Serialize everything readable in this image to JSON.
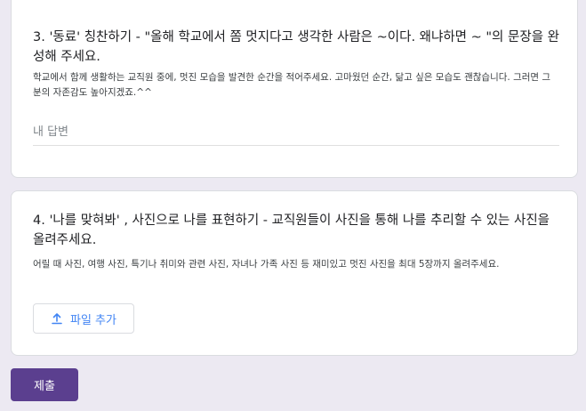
{
  "question_3": {
    "title": "3. '동료' 칭찬하기 - \"올해 학교에서 쫌 멋지다고 생각한 사람은 ~이다. 왜냐하면 ~ \"의 문장을 완성해 주세요.",
    "description": "학교에서 함께 생활하는 교직원 중에, 멋진 모습을 발견한 순간을 적어주세요. 고마웠던 순간, 닮고 싶은 모습도 괜찮습니다. 그러면 그 분의 자존감도 높아지겠죠.^^",
    "answer_placeholder": "내 답변",
    "answer_value": ""
  },
  "question_4": {
    "title": "4. '나를 맞혀봐' , 사진으로 나를 표현하기 - 교직원들이 사진을 통해 나를 추리할 수 있는 사진을 올려주세요.",
    "description": "어릴 때 사진, 여행 사진, 특기나 취미와 관련 사진, 자녀나 가족 사진 등 재미있고 멋진 사진을 최대 5장까지 올려주세요.",
    "upload_label": "파일 추가",
    "upload_icon": "upload-icon"
  },
  "submit_label": "제출",
  "colors": {
    "background": "#ece9f2",
    "card": "#ffffff",
    "accent": "#5b3f8f",
    "upload_text": "#4285f4"
  }
}
